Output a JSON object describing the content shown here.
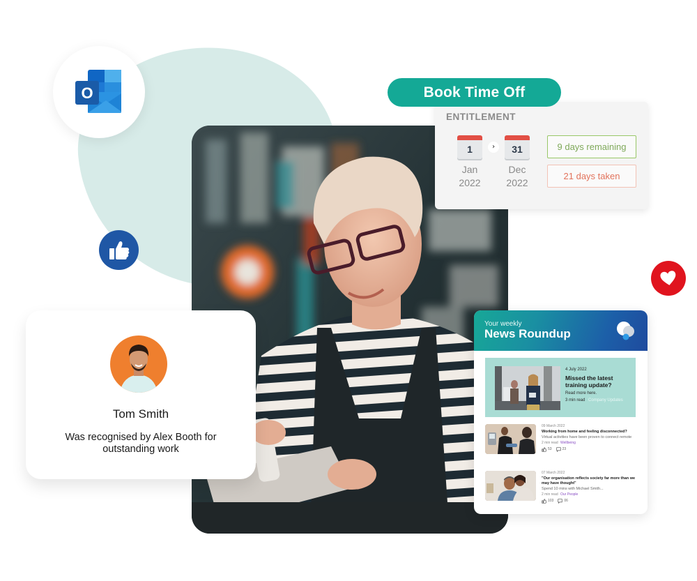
{
  "outlook": {
    "icon": "outlook-icon",
    "letter": "O"
  },
  "reactions": {
    "like_icon": "thumbs-up-icon",
    "love_icon": "heart-icon"
  },
  "book_time_off": {
    "button_label": "Book Time Off",
    "entitlement_title": "ENTITLEMENT",
    "start": {
      "day": "1",
      "month": "Jan",
      "year": "2022"
    },
    "end": {
      "day": "31",
      "month": "Dec",
      "year": "2022"
    },
    "arrow_glyph": "›",
    "remaining_label": "9 days remaining",
    "taken_label": "21 days taken",
    "colors": {
      "button": "#14a996",
      "remaining": "#98c767",
      "taken": "#e2735c",
      "calendar_top": "#e24f45"
    }
  },
  "recognition": {
    "name": "Tom Smith",
    "message": "Was recognised by Alex Booth for outstanding work",
    "avatar_color": "#ef7f2e"
  },
  "news": {
    "subtitle": "Your weekly",
    "title": "News Roundup",
    "feature": {
      "date": "4 July 2022",
      "headline": "Missed the latest training update?",
      "description": "Read more here.",
      "read_time": "3 min read",
      "category": "Company Updates"
    },
    "articles": [
      {
        "date": "09 March 2022",
        "headline": "Working from home and feeling disconnected?",
        "description": "Virtual activities have been proven to connect remote",
        "read_time": "2 min read",
        "category": "Wellbeing",
        "likes": "53",
        "comments": "23"
      },
      {
        "date": "07 March 2022",
        "headline": "\"Our organisation reflects society far more than we may have thought\"",
        "description": "Spend 10 mins with Michael Smith...",
        "read_time": "2 min read",
        "category": "Our People",
        "likes": "103",
        "comments": "06"
      }
    ]
  }
}
